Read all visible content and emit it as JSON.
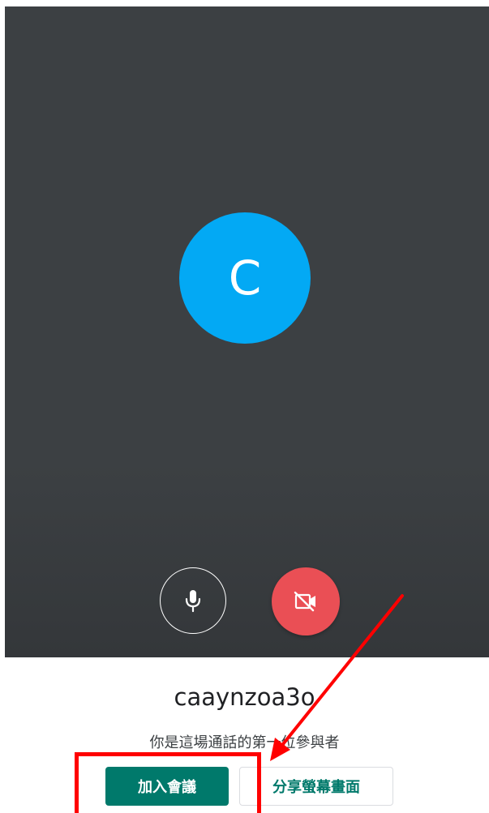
{
  "preview": {
    "avatar_letter": "C",
    "mic_icon": "microphone-icon",
    "camera_icon": "video-off-icon"
  },
  "meeting": {
    "code": "caaynzoa3o",
    "note": "你是這場通話的第一位參與者"
  },
  "actions": {
    "join_label": "加入會議",
    "share_label": "分享螢幕畫面"
  },
  "colors": {
    "preview_bg": "#3c4043",
    "avatar_bg": "#03a9f4",
    "camera_off": "#ea4f55",
    "primary": "#00796b",
    "annotation": "#ff0000"
  }
}
